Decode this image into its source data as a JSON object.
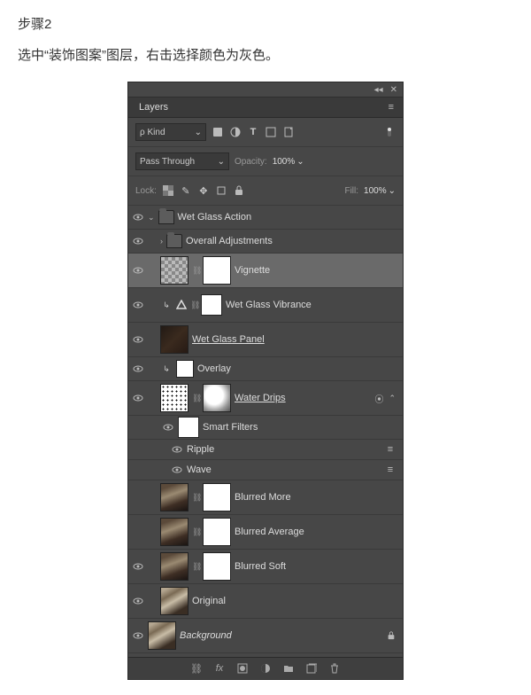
{
  "step_title": "步骤2",
  "step_desc": "选中“装饰图案”图层，右击选择颜色为灰色。",
  "panel_tab": "Layers",
  "filter_kind_prefix": "ρ",
  "filter_kind": "Kind",
  "blend_mode": "Pass Through",
  "opacity_label": "Opacity:",
  "opacity_value": "100%",
  "lock_label": "Lock:",
  "fill_label": "Fill:",
  "fill_value": "100%",
  "layers": {
    "group": "Wet Glass Action",
    "adjustments": "Overall Adjustments",
    "vignette": "Vignette",
    "vibrance": "Wet Glass Vibrance",
    "panel": "Wet Glass Panel ",
    "overlay": "Overlay",
    "drips": "Water Drips ",
    "smartf": "Smart Filters",
    "ripple": "Ripple",
    "wave": "Wave",
    "blur_more": "Blurred More",
    "blur_avg": "Blurred Average",
    "blur_soft": "Blurred Soft",
    "original": "Original",
    "background": "Background"
  },
  "chart_data": null
}
